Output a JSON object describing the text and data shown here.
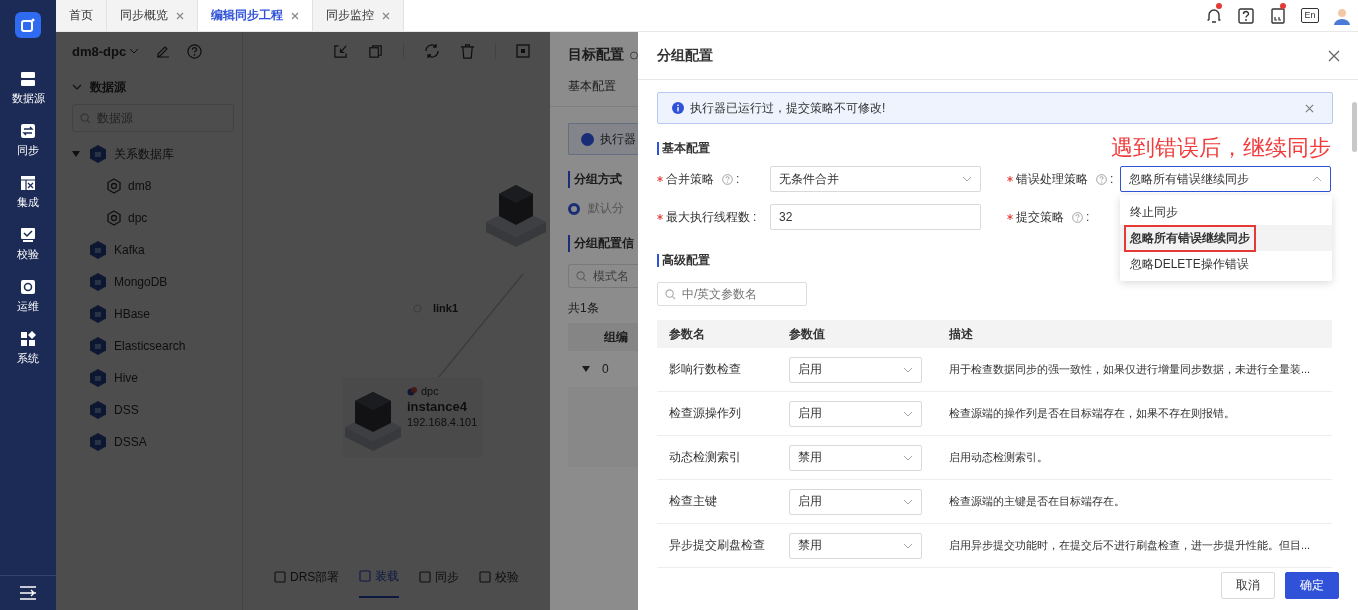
{
  "sidebar": {
    "items": [
      {
        "label": "数据源",
        "kind": "server"
      },
      {
        "label": "同步",
        "kind": "sync"
      },
      {
        "label": "集成",
        "kind": "grid"
      },
      {
        "label": "校验",
        "kind": "check"
      },
      {
        "label": "运维",
        "kind": "gear"
      },
      {
        "label": "系统",
        "kind": "apps"
      }
    ]
  },
  "tabs": [
    {
      "label": "首页",
      "closable": false,
      "selected": false
    },
    {
      "label": "同步概览",
      "closable": true,
      "selected": false
    },
    {
      "label": "编辑同步工程",
      "closable": true,
      "selected": true
    },
    {
      "label": "同步监控",
      "closable": true,
      "selected": false
    }
  ],
  "header_icons": [
    {
      "kind": "bell",
      "dot": true
    },
    {
      "kind": "help"
    },
    {
      "kind": "doc",
      "dot": true
    },
    {
      "kind": "language",
      "label": "En"
    },
    {
      "kind": "avatar"
    }
  ],
  "project": {
    "name": "dm8-dpc"
  },
  "tree": {
    "title": "数据源",
    "expanded": true,
    "search_placeholder": "数据源",
    "items": [
      {
        "label": "关系数据库",
        "expanded": true,
        "children": [
          {
            "label": "dm8"
          },
          {
            "label": "dpc"
          }
        ]
      },
      {
        "label": "Kafka"
      },
      {
        "label": "MongoDB"
      },
      {
        "label": "HBase"
      },
      {
        "label": "Elasticsearch"
      },
      {
        "label": "Hive"
      },
      {
        "label": "DSS"
      },
      {
        "label": "DSSA"
      }
    ]
  },
  "canvas": {
    "link_label": "link1",
    "node": {
      "type": "dpc",
      "name": "instance4",
      "ip": "192.168.4.101"
    },
    "bottom_tabs": [
      {
        "label": "DRS部署",
        "selected": false
      },
      {
        "label": "装载",
        "selected": true
      },
      {
        "label": "同步",
        "selected": false
      },
      {
        "label": "校验",
        "selected": false
      }
    ]
  },
  "target_panel": {
    "title": "目标配置",
    "tab": "基本配置",
    "alert": "执行器",
    "group_mode_title": "分组方式",
    "radio": {
      "label": "默认分",
      "selected": true
    },
    "group_info_title": "分组配置信",
    "search_placeholder": "模式名",
    "count": "共1条",
    "column": "组编",
    "row": {
      "id": "0",
      "expanded": true
    }
  },
  "drawer": {
    "title": "分组配置",
    "alert": "执行器已运行过，提交策略不可修改!",
    "annotation": "遇到错误后，继续同步",
    "basic": {
      "title": "基本配置",
      "rows": [
        {
          "fields": [
            {
              "label": "合并策略",
              "required": true,
              "help": true,
              "colon": ":",
              "kind": "select",
              "value": "无条件合并",
              "open": false
            },
            {
              "label": "错误处理策略",
              "required": true,
              "help": true,
              "colon": ":",
              "kind": "select",
              "value": "忽略所有错误继续同步",
              "open": true,
              "options": [
                {
                  "label": "终止同步",
                  "selected": false,
                  "annotated": false
                },
                {
                  "label": "忽略所有错误继续同步",
                  "selected": true,
                  "annotated": true
                },
                {
                  "label": "忽略DELETE操作错误",
                  "selected": false,
                  "annotated": false
                }
              ]
            }
          ]
        },
        {
          "fields": [
            {
              "label": "最大执行线程数",
              "required": true,
              "colon": ":",
              "kind": "input",
              "value": "32"
            },
            {
              "label": "提交策略",
              "required": true,
              "help": true,
              "colon": ":"
            }
          ]
        }
      ]
    },
    "advanced": {
      "title": "高级配置",
      "search_placeholder": "中/英文参数名",
      "columns": [
        "参数名",
        "参数值",
        "描述"
      ],
      "rows": [
        {
          "name": "影响行数检查",
          "value": "启用",
          "description": "用于检查数据同步的强一致性，如果仅进行增量同步数据，未进行全量装..."
        },
        {
          "name": "检查源操作列",
          "value": "启用",
          "description": "检查源端的操作列是否在目标端存在，如果不存在则报错。"
        },
        {
          "name": "动态检测索引",
          "value": "禁用",
          "description": "启用动态检测索引。"
        },
        {
          "name": "检查主键",
          "value": "启用",
          "description": "检查源端的主键是否在目标端存在。"
        },
        {
          "name": "异步提交刷盘检查",
          "value": "禁用",
          "description": "启用异步提交功能时，在提交后不进行刷盘检查，进一步提升性能。但目..."
        }
      ]
    },
    "buttons": [
      {
        "label": "取消",
        "kind": "secondary"
      },
      {
        "label": "确定",
        "kind": "primary"
      }
    ]
  }
}
